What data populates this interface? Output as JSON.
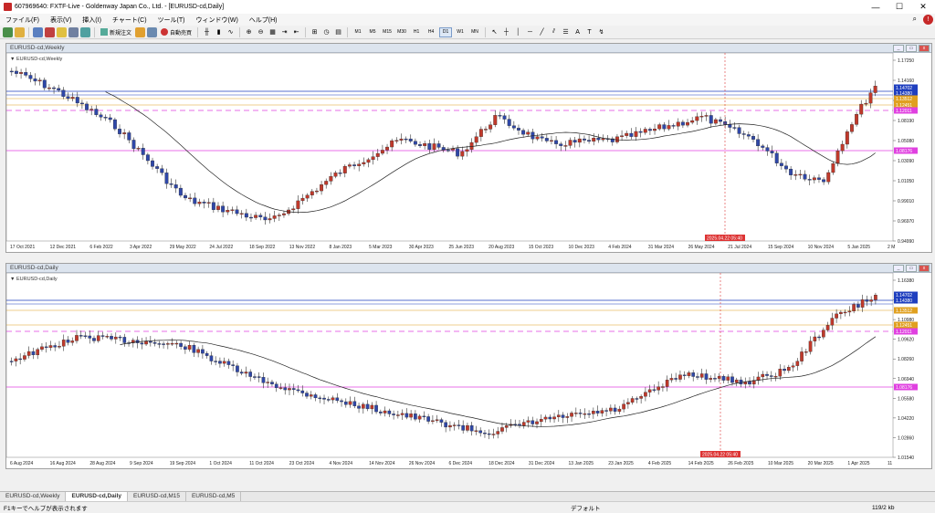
{
  "window": {
    "title": "607969640: FXTF-Live - Goldenway Japan Co., Ltd. - [EURUSD-cd,Daily]"
  },
  "menu": [
    "ファイル(F)",
    "表示(V)",
    "挿入(I)",
    "チャート(C)",
    "ツール(T)",
    "ウィンドウ(W)",
    "ヘルプ(H)"
  ],
  "toolbar": {
    "new_order": "新規注文",
    "auto_trade": "自動売買",
    "timeframes": [
      "M1",
      "M5",
      "M15",
      "M30",
      "H1",
      "H4",
      "D1",
      "W1",
      "MN"
    ],
    "active_timeframe": "D1"
  },
  "weekly": {
    "window_title": "EURUSD-cd,Weekly",
    "inner_label": "EURUSD-cd,Weekly",
    "price_ticks": [
      "1.17250",
      "1.14160",
      "1.11170",
      "1.08190",
      "1.05080",
      "1.03090",
      "1.01050",
      "0.99010",
      "0.96970",
      "0.94990"
    ],
    "date_ticks": [
      "17 Oct 2021",
      "12 Dec 2021",
      "6 Feb 2022",
      "3 Apr 2022",
      "29 May 2022",
      "24 Jul 2022",
      "18 Sep 2022",
      "13 Nov 2022",
      "8 Jan 2023",
      "5 Mar 2023",
      "30 Apr 2023",
      "25 Jun 2023",
      "20 Aug 2023",
      "15 Oct 2023",
      "10 Dec 2023",
      "4 Feb 2024",
      "31 Mar 2024",
      "26 May 2024",
      "21 Jul 2024",
      "15 Sep 2024",
      "10 Nov 2024",
      "5 Jan 2025",
      "2 M"
    ],
    "time_label": "2025.04.22 05:40",
    "price_tags": [
      {
        "text": "1.14702",
        "color": "#1f3fbf"
      },
      {
        "text": "1.14380",
        "color": "#1f3fbf"
      },
      {
        "text": "1.13512",
        "color": "#e0a020"
      },
      {
        "text": "1.12451",
        "color": "#e0a020"
      },
      {
        "text": "1.12011",
        "color": "#e040e0"
      },
      {
        "text": "1.08176",
        "color": "#e040e0"
      }
    ]
  },
  "daily": {
    "window_title": "EURUSD-cd,Daily",
    "inner_label": "EURUSD-cd,Daily",
    "price_ticks": [
      "1.16380",
      "1.13660",
      "1.10980",
      "1.09620",
      "1.08260",
      "1.06940",
      "1.05580",
      "1.04220",
      "1.02860",
      "1.01540"
    ],
    "date_ticks": [
      "6 Aug 2024",
      "16 Aug 2024",
      "28 Aug 2024",
      "9 Sep 2024",
      "19 Sep 2024",
      "1 Oct 2024",
      "11 Oct 2024",
      "23 Oct 2024",
      "4 Nov 2024",
      "14 Nov 2024",
      "26 Nov 2024",
      "6 Dec 2024",
      "18 Dec 2024",
      "31 Dec 2024",
      "13 Jan 2025",
      "23 Jan 2025",
      "4 Feb 2025",
      "14 Feb 2025",
      "26 Feb 2025",
      "10 Mar 2025",
      "20 Mar 2025",
      "1 Apr 2025",
      "11"
    ],
    "time_label": "2025.04.22 05:40",
    "price_tags": [
      {
        "text": "1.14702",
        "color": "#1f3fbf"
      },
      {
        "text": "1.14380",
        "color": "#1f3fbf"
      },
      {
        "text": "1.13512",
        "color": "#e0a020"
      },
      {
        "text": "1.12451",
        "color": "#e0a020"
      },
      {
        "text": "1.12011",
        "color": "#e040e0"
      },
      {
        "text": "1.08176",
        "color": "#e040e0"
      }
    ]
  },
  "tabs": [
    "EURUSD-cd,Weekly",
    "EURUSD-cd,Daily",
    "EURUSD-cd,M15",
    "EURUSD-cd,M5"
  ],
  "active_tab": "EURUSD-cd,Daily",
  "status": {
    "help": "F1キーでヘルプが表示されます",
    "profile": "デフォルト",
    "traffic": "119/2 kb"
  }
}
